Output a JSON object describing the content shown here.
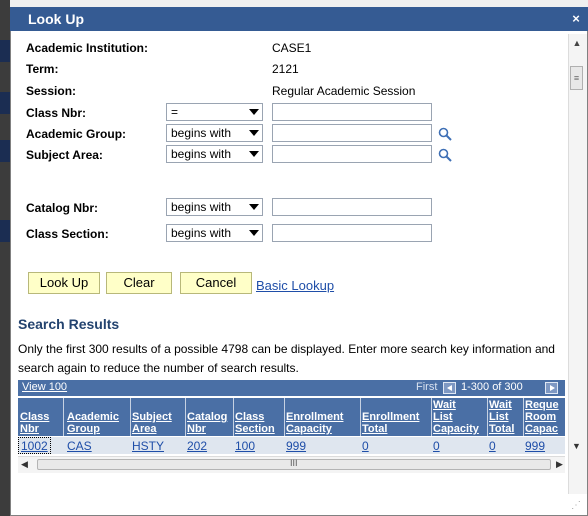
{
  "dialog": {
    "title": "Look Up",
    "close_glyph": "×"
  },
  "criteria": {
    "institution": {
      "label": "Academic Institution:",
      "value": "CASE1"
    },
    "term": {
      "label": "Term:",
      "value": "2121"
    },
    "session": {
      "label": "Session:",
      "value": "Regular Academic Session"
    },
    "class_nbr": {
      "label": "Class Nbr:",
      "operator": "=",
      "value": ""
    },
    "academic_group": {
      "label": "Academic Group:",
      "operator": "begins with",
      "value": ""
    },
    "subject_area": {
      "label": "Subject Area:",
      "operator": "begins with",
      "value": ""
    },
    "catalog_nbr": {
      "label": "Catalog Nbr:",
      "operator": "begins with",
      "value": ""
    },
    "class_section": {
      "label": "Class Section:",
      "operator": "begins with",
      "value": ""
    }
  },
  "buttons": {
    "lookup": "Look Up",
    "clear": "Clear",
    "cancel": "Cancel",
    "basic_lookup": "Basic Lookup"
  },
  "results": {
    "title": "Search Results",
    "note": "Only the first 300 results of a possible 4798 can be displayed. Enter more search key information and search again to reduce the number of search results.",
    "view_link": "View 100",
    "first_label": "First",
    "range": "1-300 of 300",
    "columns": [
      {
        "line1": "Class",
        "line2": "Nbr",
        "line3": ""
      },
      {
        "line1": "Academic",
        "line2": "Group",
        "line3": ""
      },
      {
        "line1": "Subject",
        "line2": "Area",
        "line3": ""
      },
      {
        "line1": "Catalog",
        "line2": "Nbr",
        "line3": ""
      },
      {
        "line1": "Class",
        "line2": "Section",
        "line3": ""
      },
      {
        "line1": "Enrollment",
        "line2": "Capacity",
        "line3": ""
      },
      {
        "line1": "Enrollment",
        "line2": "Total",
        "line3": ""
      },
      {
        "line1": "Wait",
        "line2": "List",
        "line3": "Capacity"
      },
      {
        "line1": "Wait",
        "line2": "List",
        "line3": "Total"
      },
      {
        "line1": "Reque",
        "line2": "Room",
        "line3": "Capac"
      }
    ],
    "row": [
      "1002",
      "CAS",
      "HSTY",
      "202",
      "100",
      "999",
      "0",
      "0",
      "0",
      "999"
    ]
  },
  "scroll": {
    "h_grip": "III"
  },
  "colors": {
    "title_bar": "#355b93",
    "grid_header": "#4a6fa5",
    "button_bg": "#ffffc8",
    "link": "#1f4ea8"
  }
}
